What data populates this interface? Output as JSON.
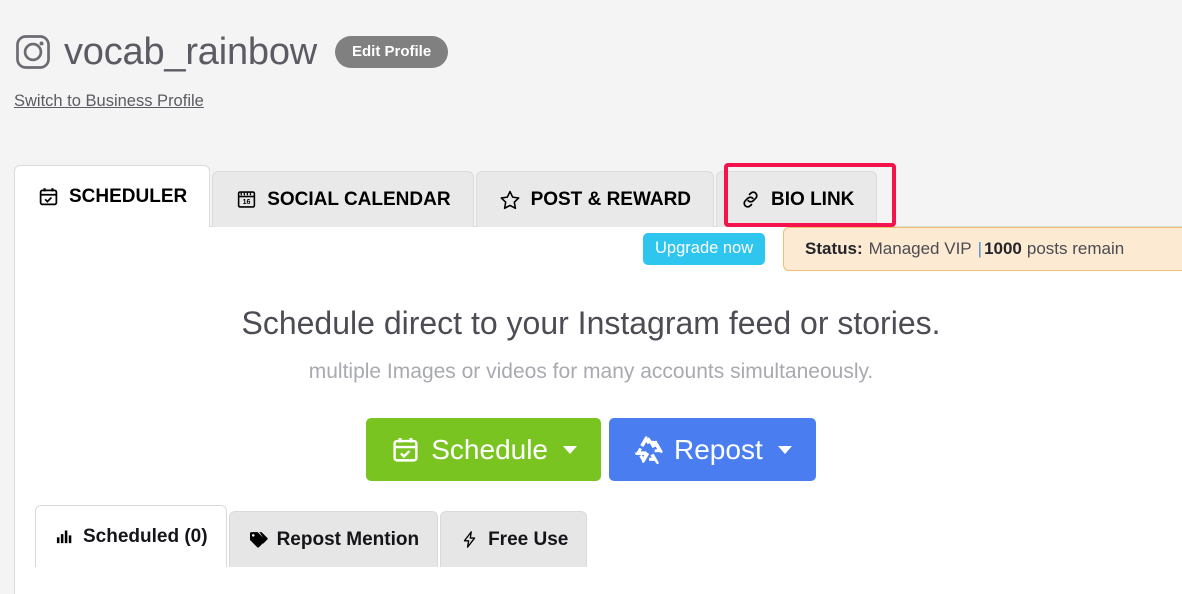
{
  "header": {
    "platform_icon": "instagram-icon",
    "account_name": "vocab_rainbow",
    "edit_profile_label": "Edit Profile",
    "switch_profile_label": "Switch to Business Profile"
  },
  "main_tabs": [
    {
      "label": "SCHEDULER",
      "icon": "calendar-check-icon",
      "active": true,
      "highlighted": false
    },
    {
      "label": "SOCIAL CALENDAR",
      "icon": "calendar-16-icon",
      "active": false,
      "highlighted": false
    },
    {
      "label": "POST & REWARD",
      "icon": "star-icon",
      "active": false,
      "highlighted": false
    },
    {
      "label": "BIO LINK",
      "icon": "link-icon",
      "active": false,
      "highlighted": true
    }
  ],
  "status_bar": {
    "upgrade_label": "Upgrade now",
    "status_label": "Status:",
    "plan": "Managed VIP",
    "separator": "|",
    "quota_count": "1000",
    "quota_text": "posts remain"
  },
  "hero": {
    "title": "Schedule direct to your Instagram feed or stories.",
    "subtitle": "multiple Images or videos for many accounts simultaneously."
  },
  "actions": [
    {
      "label": "Schedule",
      "icon": "calendar-check-icon",
      "color": "#7ac422"
    },
    {
      "label": "Repost",
      "icon": "recycle-icon",
      "color": "#4a7ef0"
    }
  ],
  "sub_tabs": [
    {
      "label": "Scheduled (0)",
      "icon": "bar-chart-icon",
      "active": true
    },
    {
      "label": "Repost Mention",
      "icon": "tag-icon",
      "active": false
    },
    {
      "label": "Free Use",
      "icon": "lightning-icon",
      "active": false
    }
  ],
  "colors": {
    "highlight_box": "#f4134c",
    "upgrade_button": "#2ec5ee",
    "banner_background": "#fcebd2",
    "banner_border": "#f0c070",
    "schedule_green": "#7ac422",
    "repost_blue": "#4a7ef0",
    "edit_profile_gray": "#808080",
    "page_background": "#f4f4f4"
  }
}
